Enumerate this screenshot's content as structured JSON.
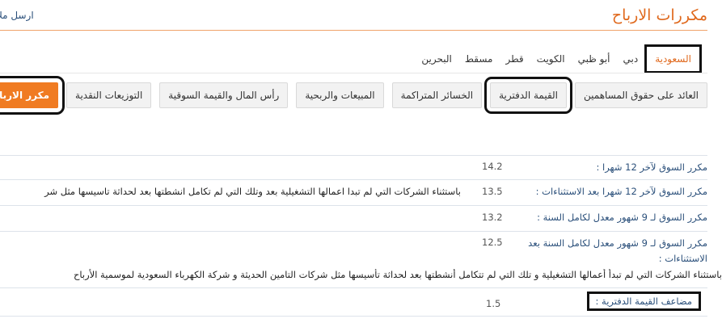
{
  "header": {
    "title": "مكررات الارباح",
    "send_link": "ارسل ملا"
  },
  "country_tabs": [
    {
      "label": "السعودية",
      "active": true
    },
    {
      "label": "دبي",
      "active": false
    },
    {
      "label": "أبو ظبي",
      "active": false
    },
    {
      "label": "الكويت",
      "active": false
    },
    {
      "label": "قطر",
      "active": false
    },
    {
      "label": "مسقط",
      "active": false
    },
    {
      "label": "البحرين",
      "active": false
    }
  ],
  "sub_tabs": [
    {
      "label": "العائد على حقوق المساهمين"
    },
    {
      "label": "القيمة الدفترية"
    },
    {
      "label": "الخسائر المتراكمة"
    },
    {
      "label": "المبيعات والربحية"
    },
    {
      "label": "رأس المال والقيمة السوقية"
    },
    {
      "label": "التوزيعات النقدية"
    },
    {
      "label": "مكرر الارباح"
    }
  ],
  "metrics": [
    {
      "label": "مكرر السوق لآخر 12 شهرا :",
      "value": "14.2"
    },
    {
      "label": "مكرر السوق لآخر 12 شهرا بعد الاستثناءات :",
      "value": "13.5",
      "note": "باستثناء الشركات التي لم تبدا اعمالها التشغيلية بعد وتلك التي لم تكامل انشطتها بعد لحداثة تاسيسها مثل شر"
    },
    {
      "label": "مكرر السوق لـ 9 شهور معدل لكامل السنة :",
      "value": "13.2"
    },
    {
      "label_line1": "مكرر السوق لـ 9 شهور معدل لكامل السنة بعد",
      "label_line2": "الاستثناءات :",
      "value": "12.5",
      "note": "باستثناء الشركات التي لم تبدأ أعمالها التشغيلية و تلك التي لم تتكامل أنشطتها بعد لحداثة تأسيسها مثل شركات التامين الحديثة و شركة الكهرباء السعودية لموسمية الأرباح"
    },
    {
      "label": "مضاعف القيمة الدفترية :",
      "value": "1.5"
    }
  ]
}
